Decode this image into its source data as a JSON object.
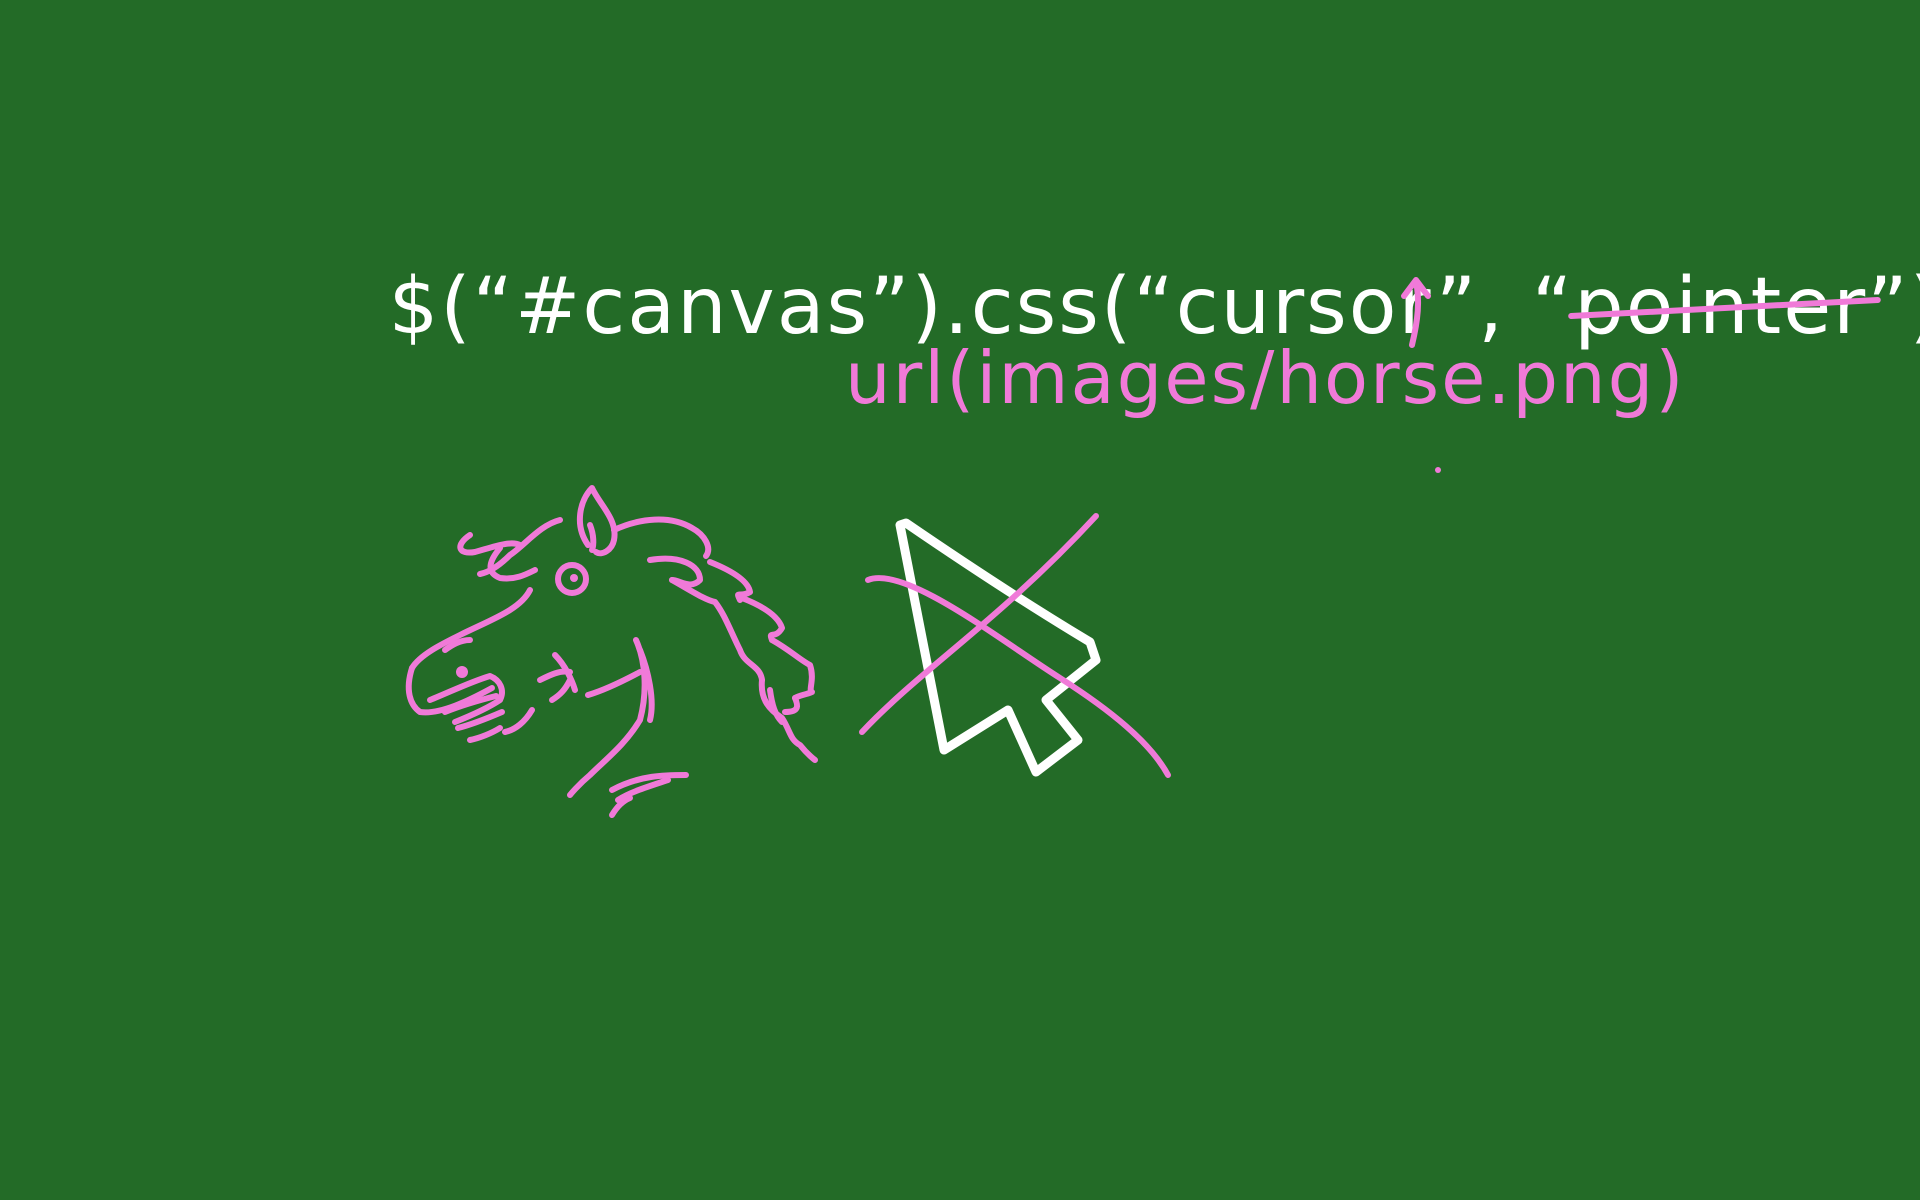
{
  "colors": {
    "board": "#236b27",
    "chalk_white": "#ffffff",
    "chalk_pink": "#f07ad8"
  },
  "code": {
    "prefix": "$(“#canvas”).css(“cursor”, “",
    "struck_word": "pointer",
    "suffix": "”);"
  },
  "replacement": "url(images/horse.png)",
  "icons": {
    "correction_arrow": "up-arrow-icon",
    "horse": "horse-head-icon",
    "cursor": "pointer-cursor-icon",
    "cross": "cross-out-icon"
  }
}
